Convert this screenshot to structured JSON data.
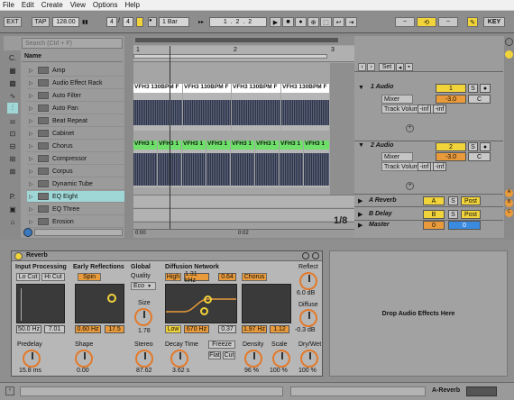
{
  "menu": [
    "File",
    "Edit",
    "Create",
    "View",
    "Options",
    "Help"
  ],
  "toolbar": {
    "ext": "EXT",
    "tap": "TAP",
    "tempo": "128.00",
    "sig_num": "4",
    "sig_den": "4",
    "quant": "1 Bar",
    "position": "1 .   2 .   2",
    "key": "KEY"
  },
  "browser": {
    "search_placeholder": "Search (Ctrl + F)",
    "header": "Name",
    "items": [
      "Amp",
      "Audio Effect Rack",
      "Auto Filter",
      "Auto Pan",
      "Beat Repeat",
      "Cabinet",
      "Chorus",
      "Compressor",
      "Corpus",
      "Dynamic Tube",
      "EQ Eight",
      "EQ Three",
      "Erosion"
    ],
    "selected": "EQ Eight"
  },
  "arrangement": {
    "ruler": [
      "1",
      "2",
      "3"
    ],
    "clip_name": "VFH3 130BPM F",
    "clip_name_b": "VFH3 1",
    "scroll_times": [
      "0:00",
      "0:02"
    ],
    "fraction": "1/8"
  },
  "mixer": {
    "set": "Set",
    "tracks": [
      {
        "name": "1 Audio",
        "num": "1",
        "route": "Mixer",
        "param": "Track Volume",
        "vol": "-3.0",
        "pan": "C",
        "inf1": "-inf",
        "inf2": "-inf"
      },
      {
        "name": "2 Audio",
        "num": "2",
        "route": "Mixer",
        "param": "Track Volume",
        "vol": "-3.0",
        "pan": "C",
        "inf1": "-inf",
        "inf2": "-inf"
      }
    ],
    "returns": [
      {
        "name": "A Reverb",
        "letter": "A",
        "post": "Post"
      },
      {
        "name": "B Delay",
        "letter": "B",
        "post": "Post"
      }
    ],
    "master": {
      "name": "Master",
      "val": "0",
      "val2": "0"
    },
    "solo": "S",
    "sends_right": [
      "A",
      "B",
      "C"
    ]
  },
  "device": {
    "title": "Reverb",
    "input_processing": "Input Processing",
    "lo_cut": "Lo Cut",
    "hi_cut": "Hi Cut",
    "in_freq": "50.0 Hz",
    "in_w": "7.01",
    "early": "Early Reflections",
    "spin": "Spin",
    "er_freq": "0.60 Hz",
    "er_amt": "17.5",
    "global": "Global",
    "quality": "Quality",
    "eco": "Eco",
    "size_lbl": "Size",
    "size": "1.78",
    "diffusion": "Diffusion Network",
    "high": "High",
    "high_freq": "1.31 kHz",
    "high_val": "0.64",
    "chorus": "Chorus",
    "low": "Low",
    "low_freq": "670 Hz",
    "low_val": "0.37",
    "ch_freq": "1.97 Hz",
    "ch_val": "1.12",
    "reflect": "Reflect",
    "reflect_val": "6.0 dB",
    "diffuse": "Diffuse",
    "diffuse_val": "-0.3 dB",
    "predelay": "Predelay",
    "predelay_val": "15.8 ms",
    "shape": "Shape",
    "shape_val": "0.00",
    "stereo": "Stereo",
    "stereo_val": "87.62",
    "decay": "Decay Time",
    "decay_val": "3.62 s",
    "freeze": "Freeze",
    "flat": "Flat",
    "cut": "Cut",
    "density": "Density",
    "density_val": "96 %",
    "scale": "Scale",
    "scale_val": "100 %",
    "drywet": "Dry/Wet",
    "drywet_val": "100 %"
  },
  "drop_text": "Drop Audio Effects Here",
  "status": {
    "track": "A-Reverb"
  },
  "colors": {
    "accent": "#e99a3a",
    "yellow": "#f1d33a",
    "clip_blue_bg": "#ffffff",
    "clip_green": "#6ee06a",
    "selection": "#9fd6d6"
  }
}
